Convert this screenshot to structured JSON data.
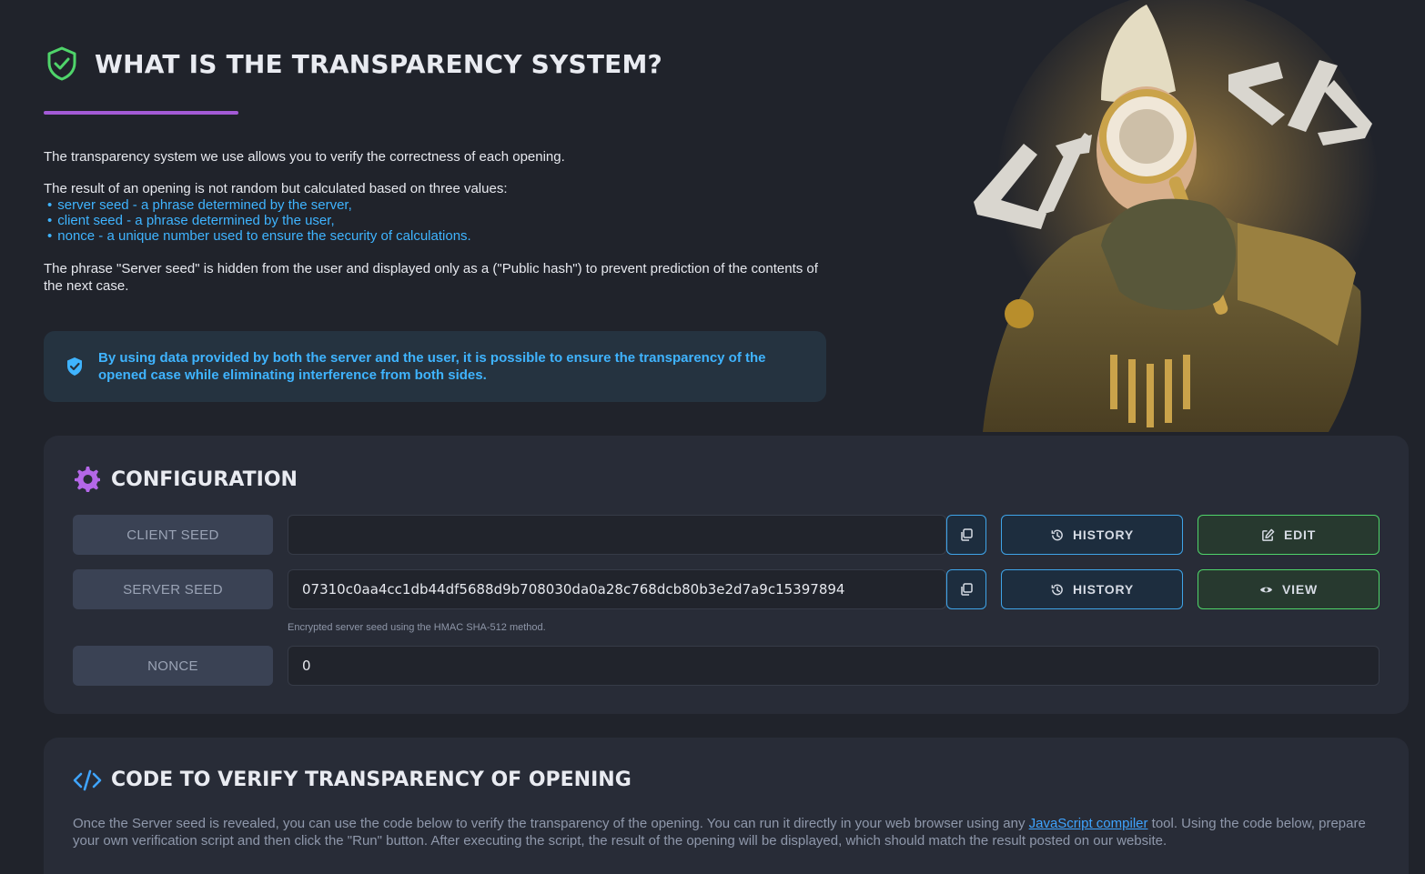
{
  "hero": {
    "title": "WHAT IS THE TRANSPARENCY SYSTEM?",
    "intro": "The transparency system we use allows you to verify the correctness of each opening.",
    "result_text": "The result of an opening is not random but calculated based on three values:",
    "values": [
      "server seed - a phrase determined by the server,",
      "client seed - a phrase determined by the user,",
      "nonce - a unique number used to ensure the security of calculations."
    ],
    "hidden_note": "The phrase \"Server seed\" is hidden from the user and displayed only as a (\"Public hash\") to prevent prediction of the contents of the next case.",
    "info": "By using data provided by both the server and the user, it is possible to ensure the transparency of the opened case while eliminating interference from both sides."
  },
  "config": {
    "title": "CONFIGURATION",
    "client_seed": {
      "label": "CLIENT SEED",
      "value": "",
      "history_label": "HISTORY",
      "action_label": "EDIT"
    },
    "server_seed": {
      "label": "SERVER SEED",
      "value": "07310c0aa4cc1db44df5688d9b708030da0a28c768dcb80b3e2d7a9c15397894",
      "history_label": "HISTORY",
      "action_label": "VIEW",
      "hint": "Encrypted server seed using the HMAC SHA-512 method."
    },
    "nonce": {
      "label": "NONCE",
      "value": "0"
    }
  },
  "code": {
    "title": "CODE TO VERIFY TRANSPARENCY OF OPENING",
    "desc_before": "Once the Server seed is revealed, you can use the code below to verify the transparency of the opening. You can run it directly in your web browser using any ",
    "link_text": "JavaScript compiler",
    "desc_after": " tool. Using the code below, prepare your own verification script and then click the \"Run\" button. After executing the script, the result of the opening will be displayed, which should match the result posted on our website."
  },
  "colors": {
    "accent_green": "#4fd46a",
    "accent_blue": "#3fb4ff",
    "accent_purple": "#a35ad6",
    "background": "#20232b"
  }
}
